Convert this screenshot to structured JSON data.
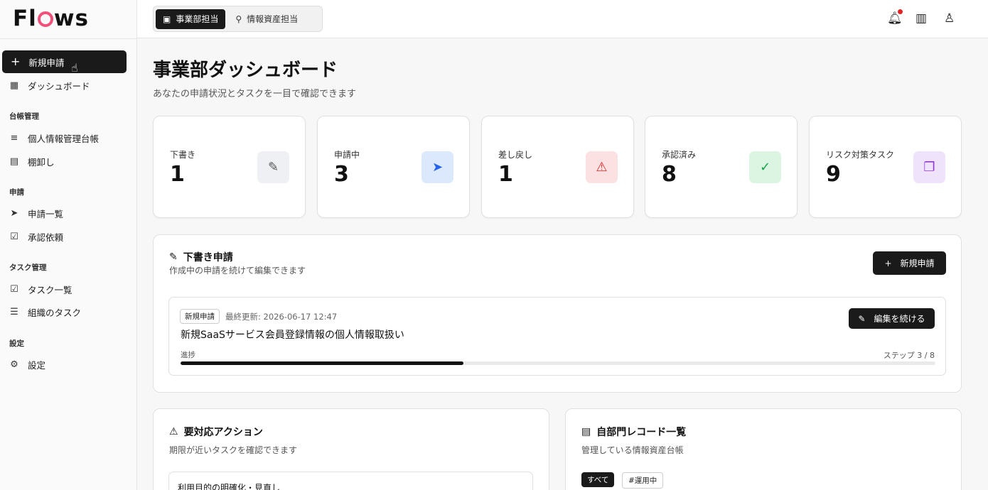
{
  "app": {
    "brand": "Flows"
  },
  "header": {
    "roles": [
      {
        "label": "事業部担当",
        "active": true
      },
      {
        "label": "情報資産担当",
        "active": false
      }
    ],
    "icons": [
      "bell-icon",
      "building-icon",
      "user-icon"
    ]
  },
  "sidebar": {
    "new_request": "新規申請",
    "dashboard": "ダッシュボード",
    "groups": {
      "ledger": "台帳管理",
      "request": "申請",
      "task": "タスク管理",
      "settings": "設定"
    },
    "items": {
      "personal_ledger": "個人情報管理台帳",
      "inventory": "棚卸し",
      "request_list": "申請一覧",
      "approval": "承認依頼",
      "task_list": "タスク一覧",
      "org_tasks": "組織のタスク",
      "settings": "設定"
    }
  },
  "page": {
    "title": "事業部ダッシュボード",
    "subtitle": "あなたの申請状況とタスクを一目で確認できます"
  },
  "stats": [
    {
      "label": "下書き",
      "value": "1",
      "icon": "pencil-icon",
      "color": "#6b7280",
      "bg": "#eef0f3"
    },
    {
      "label": "申請中",
      "value": "3",
      "icon": "send-icon",
      "color": "#2563eb",
      "bg": "#dce8fb"
    },
    {
      "label": "差し戻し",
      "value": "1",
      "icon": "warning-icon",
      "color": "#dc2626",
      "bg": "#fbe1e1"
    },
    {
      "label": "承認済み",
      "value": "8",
      "icon": "check-circle-icon",
      "color": "#16a34a",
      "bg": "#dcf5e3"
    },
    {
      "label": "リスク対策タスク",
      "value": "9",
      "icon": "copy-icon",
      "color": "#9333ea",
      "bg": "#efe3fb"
    }
  ],
  "drafts": {
    "title": "下書き申請",
    "subtitle": "作成中の申請を続けて編集できます",
    "new_button": "新規申請",
    "item": {
      "tag": "新規申請",
      "updated": "最終更新: 2026-06-17 12:47",
      "name": "新規SaaSサービス会員登録情報の個人情報取扱い",
      "progress_label": "進捗",
      "step": "ステップ 3 / 8",
      "progress": 0.375,
      "continue_button": "編集を続ける"
    }
  },
  "actions": {
    "title": "要対応アクション",
    "subtitle": "期限が近いタスクを確認できます",
    "first_item": "利用目的の明確化・見直し"
  },
  "records": {
    "title": "自部門レコード一覧",
    "subtitle": "管理している情報資産台帳",
    "filters": [
      "すべて",
      "#運用中"
    ]
  }
}
